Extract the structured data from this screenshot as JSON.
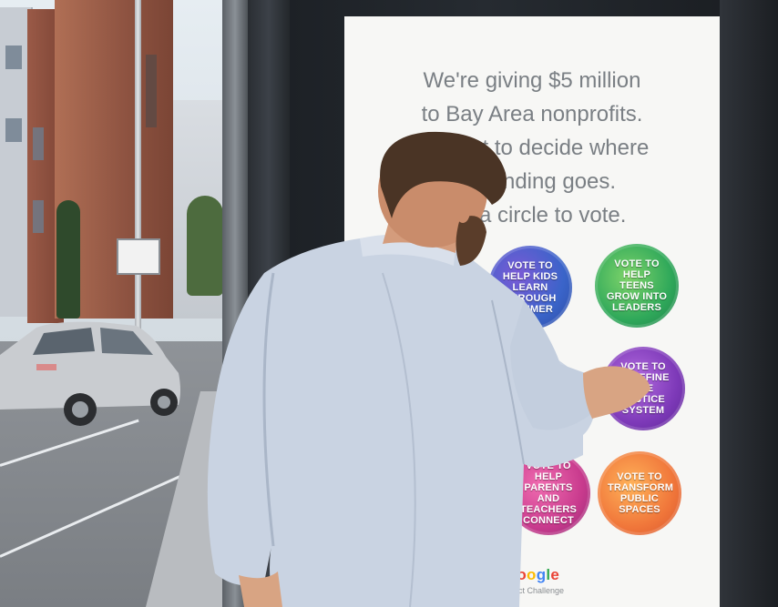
{
  "poster": {
    "headline_lines": [
      "We're giving $5 million",
      "to Bay Area nonprofits.",
      "You get to decide where",
      "the funding goes.",
      "Tap a circle to vote."
    ],
    "vote_options": [
      "Vote to help kids learn through summer",
      "Vote to help teens grow into leaders",
      "Vote to redefine the justice system",
      "Vote to help parents and teachers connect",
      "Vote to transform public spaces"
    ],
    "brand": {
      "logo_text": "Google",
      "subtitle": "Impact Challenge"
    }
  },
  "colors": {
    "poster_bg": "#f7f7f5",
    "headline_text": "#7a7f84",
    "shirt": "#c9d3e2"
  }
}
